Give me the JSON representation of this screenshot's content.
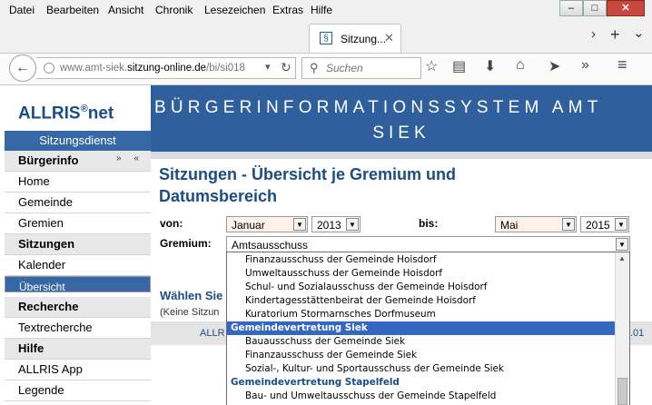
{
  "menu": [
    "Datei",
    "Bearbeiten",
    "Ansicht",
    "Chronik",
    "Lesezeichen",
    "Extras",
    "Hilfe"
  ],
  "window_controls": {
    "minimize": "–",
    "maximize": "□",
    "close": "✕"
  },
  "tab": {
    "title": "Sitzung...",
    "favicon": "§"
  },
  "tab_controls": {
    "scroll": "›",
    "new_tab": "+",
    "list": "⌄"
  },
  "address": {
    "prefix": "www.amt-siek.",
    "domain": "sitzung-online.de",
    "path": "/bi/si018"
  },
  "search": {
    "placeholder": "Suchen"
  },
  "logo": {
    "text": "ALLRIS",
    "sup": "®",
    "suffix": "net"
  },
  "service": "Sitzungsdienst",
  "nav": [
    {
      "label": "Bürgerinfo",
      "type": "head"
    },
    {
      "label": "Home",
      "type": "item"
    },
    {
      "label": "Gemeinde",
      "type": "item"
    },
    {
      "label": "Gremien",
      "type": "item"
    },
    {
      "label": "Sitzungen",
      "type": "head"
    },
    {
      "label": "Kalender",
      "type": "item"
    },
    {
      "label": "Übersicht",
      "type": "selected"
    },
    {
      "label": "Recherche",
      "type": "head"
    },
    {
      "label": "Textrecherche",
      "type": "item"
    },
    {
      "label": "Hilfe",
      "type": "head"
    },
    {
      "label": "ALLRIS App",
      "type": "item"
    },
    {
      "label": "Legende",
      "type": "item"
    }
  ],
  "banner": {
    "line1": "BÜRGERINFORMATIONSSYSTEM AMT",
    "line2": "SIEK"
  },
  "page": {
    "title": "Sitzungen - Übersicht je Gremium und Datumsbereich",
    "von_label": "von:",
    "bis_label": "bis:",
    "gremium_label": "Gremium:",
    "von_month": "Januar",
    "von_year": "2013",
    "bis_month": "Mai",
    "bis_year": "2015",
    "gremium_value": "Amtsausschuss",
    "waehlen": "Wählen Sie",
    "keine": "(Keine Sitzun",
    "allr_left": "ALLR",
    "allr_right": ".01"
  },
  "dropdown": [
    {
      "label": "Finanzausschuss der Gemeinde Hoisdorf",
      "type": "opt"
    },
    {
      "label": "Umweltausschuss der Gemeinde Hoisdorf",
      "type": "opt"
    },
    {
      "label": "Schul- und Sozialausschuss der Gemeinde Hoisdorf",
      "type": "opt"
    },
    {
      "label": "Kindertagesstättenbeirat der Gemeinde Hoisdorf",
      "type": "opt"
    },
    {
      "label": "Kuratorium Stormarnsches Dorfmuseum",
      "type": "opt"
    },
    {
      "label": "Gemeindevertretung Siek",
      "type": "group-highlight"
    },
    {
      "label": "Bauausschuss der Gemeinde Siek",
      "type": "opt"
    },
    {
      "label": "Finanzausschuss der Gemeinde Siek",
      "type": "opt"
    },
    {
      "label": "Sozial-, Kultur- und Sportausschuss der Gemeinde Siek",
      "type": "opt"
    },
    {
      "label": "Gemeindevertretung Stapelfeld",
      "type": "group"
    },
    {
      "label": "Bau- und Umweltausschuss der Gemeinde Stapelfeld",
      "type": "opt"
    }
  ],
  "colors": {
    "brand_blue": "#2f5f9c",
    "highlight": "#3367c2",
    "title_blue": "#1c4c86"
  }
}
